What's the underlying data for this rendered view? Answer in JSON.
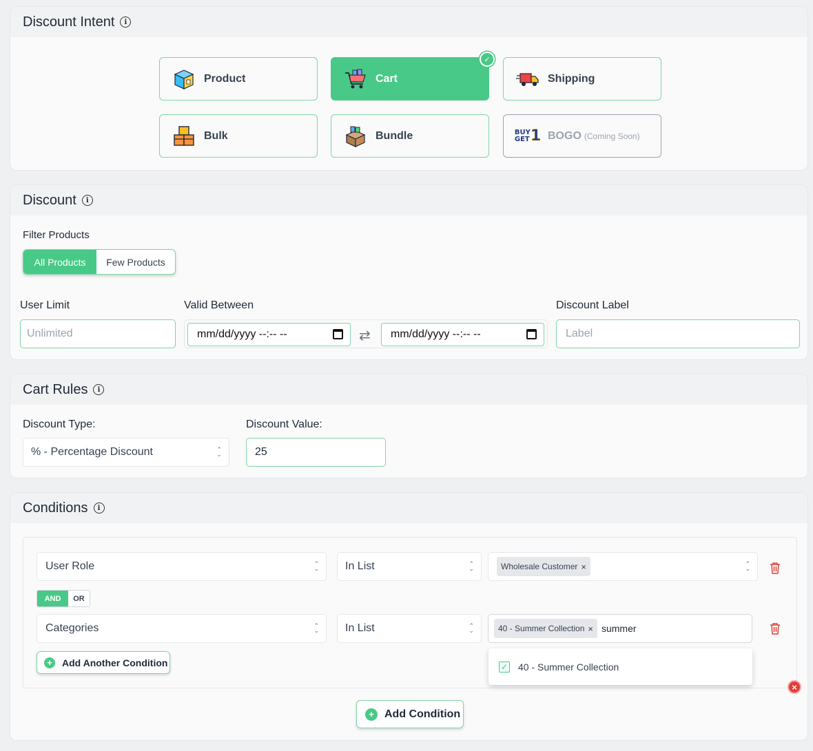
{
  "intent": {
    "title": "Discount Intent",
    "options": [
      {
        "label": "Product",
        "icon": "box-icon"
      },
      {
        "label": "Cart",
        "icon": "cart-icon",
        "selected": true
      },
      {
        "label": "Shipping",
        "icon": "truck-icon"
      },
      {
        "label": "Bulk",
        "icon": "boxes-icon"
      },
      {
        "label": "Bundle",
        "icon": "bundle-icon"
      },
      {
        "label": "BOGO",
        "icon": "buy-get-icon",
        "note": "(Coming Soon)",
        "disabled": true
      }
    ],
    "bogo_icon_text": {
      "line1": "BUY",
      "line2": "GET",
      "digit": "1"
    }
  },
  "discount": {
    "title": "Discount",
    "filter_label": "Filter Products",
    "filter_options": [
      "All Products",
      "Few Products"
    ],
    "filter_selected": "All Products",
    "user_limit_label": "User Limit",
    "user_limit_placeholder": "Unlimited",
    "valid_between_label": "Valid Between",
    "date_from": "mm/dd/yyyy --:-- --",
    "date_to": "mm/dd/yyyy --:-- --",
    "discount_label_label": "Discount Label",
    "discount_label_placeholder": "Label"
  },
  "cart_rules": {
    "title": "Cart Rules",
    "type_label": "Discount Type:",
    "type_value": "% - Percentage Discount",
    "value_label": "Discount Value:",
    "value": "25"
  },
  "conditions": {
    "title": "Conditions",
    "rows": [
      {
        "field": "User Role",
        "operator": "In List",
        "tags": [
          "Wholesale Customer"
        ],
        "search": ""
      },
      {
        "field": "Categories",
        "operator": "In List",
        "tags": [
          "40 - Summer Collection"
        ],
        "search": "summer"
      }
    ],
    "logic": [
      "AND",
      "OR"
    ],
    "logic_selected": "AND",
    "dropdown_option": "40 - Summer Collection",
    "add_another_label": "Add Another Condition",
    "add_condition_label": "Add Condition"
  },
  "colors": {
    "accent": "#49c987",
    "accent_border": "#7fd4a8",
    "danger": "#e0403a"
  }
}
